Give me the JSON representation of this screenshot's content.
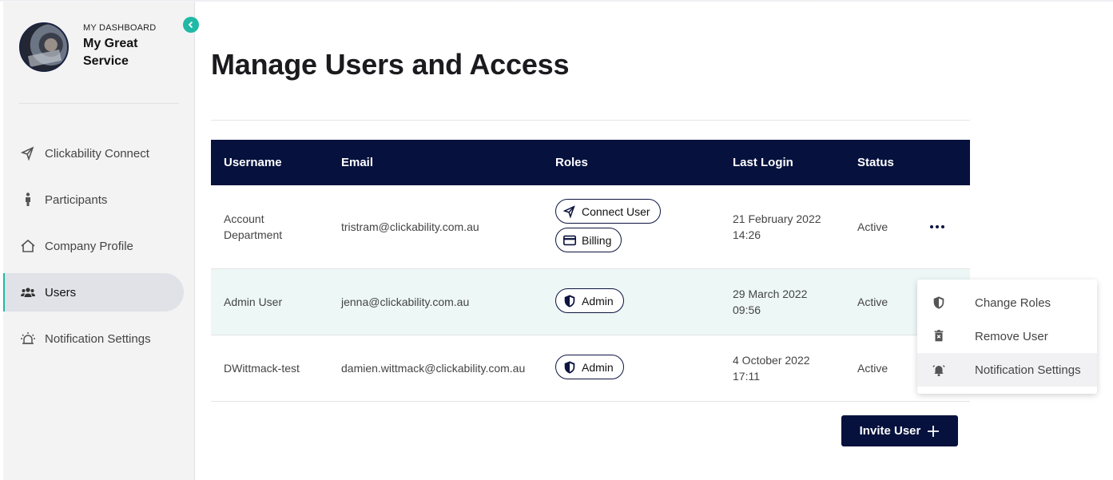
{
  "sidebar": {
    "dashboard_label": "MY DASHBOARD",
    "service_name": "My Great Service",
    "nav": [
      {
        "label": "Clickability Connect",
        "icon": "connect-icon"
      },
      {
        "label": "Participants",
        "icon": "person-icon"
      },
      {
        "label": "Company Profile",
        "icon": "home-icon"
      },
      {
        "label": "Users",
        "icon": "users-icon",
        "active": true
      },
      {
        "label": "Notification Settings",
        "icon": "alarm-icon"
      }
    ]
  },
  "main": {
    "title": "Manage Users and Access",
    "table": {
      "headers": [
        "Username",
        "Email",
        "Roles",
        "Last Login",
        "Status"
      ],
      "rows": [
        {
          "username": "Account Department",
          "email": "tristram@clickability.com.au",
          "roles": [
            "Connect User",
            "Billing"
          ],
          "last_login_date": "21 February 2022",
          "last_login_time": "14:26",
          "status": "Active"
        },
        {
          "username": "Admin User",
          "email": "jenna@clickability.com.au",
          "roles": [
            "Admin"
          ],
          "last_login_date": "29 March 2022",
          "last_login_time": "09:56",
          "status": "Active"
        },
        {
          "username": "DWittmack-test",
          "email": "damien.wittmack@clickability.com.au",
          "roles": [
            "Admin"
          ],
          "last_login_date": "4 October 2022",
          "last_login_time": "17:11",
          "status": "Active"
        }
      ]
    },
    "invite_button": "Invite User"
  },
  "menu": {
    "items": [
      {
        "label": "Change Roles",
        "icon": "shield-icon"
      },
      {
        "label": "Remove User",
        "icon": "trash-icon"
      },
      {
        "label": "Notification Settings",
        "icon": "bell-icon"
      }
    ]
  },
  "colors": {
    "navy": "#06113d",
    "teal": "#1fb9a6",
    "row_highlight": "#edf7f6"
  }
}
